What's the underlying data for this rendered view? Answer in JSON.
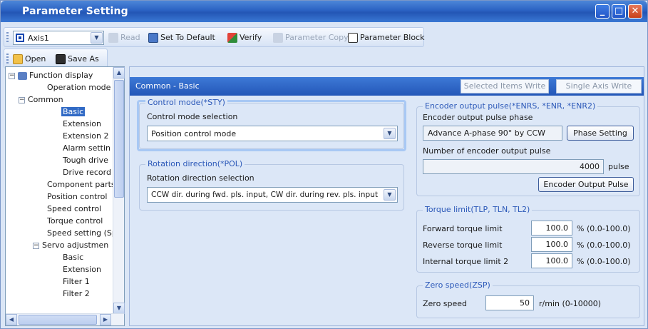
{
  "window": {
    "title": "Parameter Setting",
    "minimize_label": "_",
    "maximize_label": "□",
    "close_label": "✕"
  },
  "toolbar": {
    "axis_value": "Axis1",
    "read_label": "Read",
    "set_default_label": "Set To Default",
    "verify_label": "Verify",
    "param_copy_label": "Parameter Copy",
    "param_block_label": "Parameter Block",
    "open_label": "Open",
    "save_as_label": "Save As"
  },
  "tree": {
    "items": [
      {
        "label": "Function display",
        "expander": "⊟"
      },
      {
        "label": "Operation mode"
      },
      {
        "label": "Common",
        "expander": "⊟"
      },
      {
        "label": "Basic"
      },
      {
        "label": "Extension"
      },
      {
        "label": "Extension 2"
      },
      {
        "label": "Alarm settin"
      },
      {
        "label": "Tough drive"
      },
      {
        "label": "Drive record"
      },
      {
        "label": "Component parts"
      },
      {
        "label": "Position control"
      },
      {
        "label": "Speed control"
      },
      {
        "label": "Torque control"
      },
      {
        "label": "Speed setting (Sp"
      },
      {
        "label": "Servo adjustmen",
        "expander": "⊟"
      },
      {
        "label": "Basic"
      },
      {
        "label": "Extension"
      },
      {
        "label": "Filter 1"
      },
      {
        "label": "Filter 2"
      }
    ]
  },
  "main": {
    "header_title": "Common - Basic",
    "selected_items_write": "Selected Items Write",
    "single_axis_write": "Single Axis Write",
    "control_mode": {
      "group_title": "Control mode(*STY)",
      "field_label": "Control mode selection",
      "value": "Position control mode"
    },
    "rotation": {
      "group_title": "Rotation direction(*POL)",
      "field_label": "Rotation direction selection",
      "value": "CCW dir. during fwd. pls. input, CW dir. during rev. pls. input"
    },
    "encoder": {
      "group_title": "Encoder output pulse(*ENRS, *ENR, *ENR2)",
      "phase_label": "Encoder output pulse phase",
      "phase_value": "Advance A-phase 90° by CCW",
      "phase_button": "Phase Setting",
      "count_label": "Number of encoder output pulse",
      "count_value": "4000",
      "count_unit": "pulse",
      "button": "Encoder Output Pulse"
    },
    "torque": {
      "group_title": "Torque limit(TLP, TLN, TL2)",
      "rows": [
        {
          "label": "Forward torque limit",
          "value": "100.0",
          "unit": "% (0.0-100.0)"
        },
        {
          "label": "Reverse torque limit",
          "value": "100.0",
          "unit": "% (0.0-100.0)"
        },
        {
          "label": "Internal torque limit 2",
          "value": "100.0",
          "unit": "% (0.0-100.0)"
        }
      ]
    },
    "zero_speed": {
      "group_title": "Zero speed(ZSP)",
      "label": "Zero speed",
      "value": "50",
      "unit": "r/min (0-10000)"
    }
  }
}
